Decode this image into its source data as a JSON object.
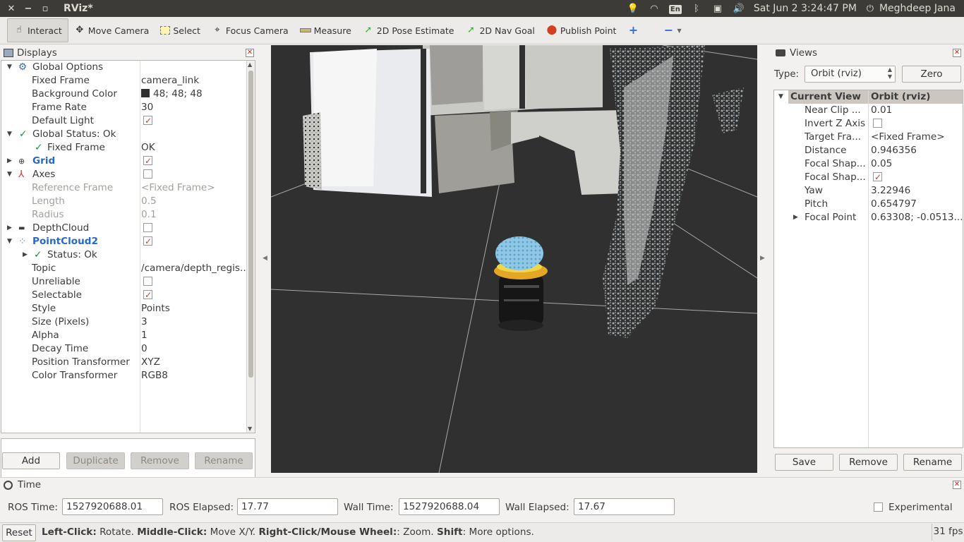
{
  "topbar": {
    "title": "RViz*",
    "clock": "Sat Jun  2  3:24:47 PM",
    "user": "Meghdeep Jana",
    "lang": "En"
  },
  "toolbar": {
    "tools": [
      {
        "label": "Interact",
        "icon": "hand-icon"
      },
      {
        "label": "Move Camera",
        "icon": "move-camera-icon"
      },
      {
        "label": "Select",
        "icon": "select-box-icon"
      },
      {
        "label": "Focus Camera",
        "icon": "focus-icon"
      },
      {
        "label": "Measure",
        "icon": "ruler-icon"
      },
      {
        "label": "2D Pose Estimate",
        "icon": "green-arrow-icon"
      },
      {
        "label": "2D Nav Goal",
        "icon": "green-arrow-icon"
      },
      {
        "label": "Publish Point",
        "icon": "pin-icon"
      }
    ]
  },
  "displays": {
    "title": "Displays",
    "rows": [
      {
        "key": "Global Options",
        "val": ""
      },
      {
        "key": "Fixed Frame",
        "val": "camera_link"
      },
      {
        "key": "Background Color",
        "val": "48; 48; 48"
      },
      {
        "key": "Frame Rate",
        "val": "30"
      },
      {
        "key": "Default Light",
        "val": ""
      },
      {
        "key": "Global Status: Ok",
        "val": ""
      },
      {
        "key": "Fixed Frame",
        "val": "OK"
      },
      {
        "key": "Grid",
        "val": ""
      },
      {
        "key": "Axes",
        "val": ""
      },
      {
        "key": "Reference Frame",
        "val": "<Fixed Frame>"
      },
      {
        "key": "Length",
        "val": "0.5"
      },
      {
        "key": "Radius",
        "val": "0.1"
      },
      {
        "key": "DepthCloud",
        "val": ""
      },
      {
        "key": "PointCloud2",
        "val": ""
      },
      {
        "key": "Status: Ok",
        "val": ""
      },
      {
        "key": "Topic",
        "val": "/camera/depth_regis..."
      },
      {
        "key": "Unreliable",
        "val": ""
      },
      {
        "key": "Selectable",
        "val": ""
      },
      {
        "key": "Style",
        "val": "Points"
      },
      {
        "key": "Size (Pixels)",
        "val": "3"
      },
      {
        "key": "Alpha",
        "val": "1"
      },
      {
        "key": "Decay Time",
        "val": "0"
      },
      {
        "key": "Position Transformer",
        "val": "XYZ"
      },
      {
        "key": "Color Transformer",
        "val": "RGB8"
      }
    ],
    "buttons": {
      "add": "Add",
      "duplicate": "Duplicate",
      "remove": "Remove",
      "rename": "Rename"
    }
  },
  "views": {
    "title": "Views",
    "type_label": "Type:",
    "type_value": "Orbit (rviz)",
    "zero": "Zero",
    "header_key": "Current View",
    "header_val": "Orbit (rviz)",
    "rows": [
      {
        "key": "Near Clip ...",
        "val": "0.01"
      },
      {
        "key": "Invert Z Axis",
        "val": ""
      },
      {
        "key": "Target Fra...",
        "val": "<Fixed Frame>"
      },
      {
        "key": "Distance",
        "val": "0.946356"
      },
      {
        "key": "Focal Shap...",
        "val": "0.05"
      },
      {
        "key": "Focal Shap...",
        "val": ""
      },
      {
        "key": "Yaw",
        "val": "3.22946"
      },
      {
        "key": "Pitch",
        "val": "0.654797"
      },
      {
        "key": "Focal Point",
        "val": "0.63308; -0.0513..."
      }
    ],
    "buttons": {
      "save": "Save",
      "remove": "Remove",
      "rename": "Rename"
    }
  },
  "time": {
    "title": "Time",
    "ros_time_label": "ROS Time:",
    "ros_time": "1527920688.01",
    "ros_elapsed_label": "ROS Elapsed:",
    "ros_elapsed": "17.77",
    "wall_time_label": "Wall Time:",
    "wall_time": "1527920688.04",
    "wall_elapsed_label": "Wall Elapsed:",
    "wall_elapsed": "17.67",
    "experimental": "Experimental"
  },
  "status": {
    "reset": "Reset",
    "fps": "31 fps",
    "b1": "Left-Click:",
    "t1": " Rotate. ",
    "b2": "Middle-Click:",
    "t2": " Move X/Y. ",
    "b3": "Right-Click/Mouse Wheel:",
    "t3": ": Zoom. ",
    "b4": "Shift",
    "t4": ": More options."
  },
  "colors": {
    "background": "#303030",
    "accent_blue": "#2569c9",
    "check_red": "#d7392a",
    "ok_green": "#1e8e3e"
  }
}
